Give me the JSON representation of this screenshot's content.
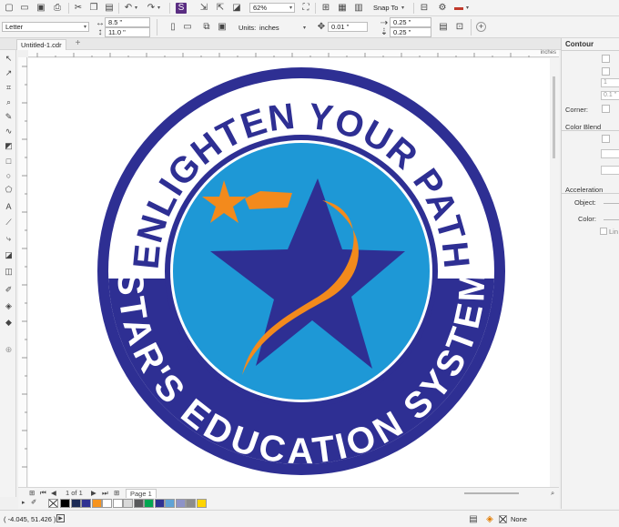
{
  "app": {
    "doc_tab": "Untitled-1.cdr",
    "add_tab": "+"
  },
  "std_toolbar": {
    "zoom": "62%",
    "snap_to": "Snap To"
  },
  "prop_bar": {
    "page_size": "Letter",
    "width": "8.5 \"",
    "height": "11.0 \"",
    "units_label": "Units:",
    "units_value": "inches",
    "nudge": "0.01 \"",
    "dup_x": "0.25 \"",
    "dup_y": "0.25 \""
  },
  "rulers": {
    "unit": "inches"
  },
  "logo": {
    "top_text": "ENLIGHTEN YOUR PATH",
    "bottom_text": "STAR'S EDUCATION SYSTEM",
    "colors": {
      "navy": "#2e2f93",
      "blue": "#1e98d6",
      "orange": "#f38a1c",
      "white": "#ffffff"
    }
  },
  "page_nav": {
    "page_count": "1 of 1",
    "page_tab": "Page 1"
  },
  "palette": {
    "swatches": [
      "#000000",
      "#1b2a55",
      "#2e3192",
      "#f7941d",
      "#ffffff",
      "#ffffff",
      "#d9d9d9",
      "#58595b",
      "#00a651",
      "#2e3192",
      "#5fa3d6",
      "#8d93c8",
      "#8c8c8c",
      "#ffd400"
    ]
  },
  "status": {
    "coordinates": "( -4.045, 51.426 )",
    "fill_label": "None"
  },
  "docker": {
    "title": "Contour",
    "steps_value": "1",
    "offset_value": "0.1 \"",
    "corner_label": "Corner:",
    "color_blend_label": "Color Blend",
    "acceleration_label": "Acceleration",
    "object_label": "Object:",
    "color_label": "Color:",
    "link_label": "Lin"
  },
  "icons": [
    "new-icon",
    "open-icon",
    "save-icon",
    "print-icon",
    "undo-icon",
    "redo-icon",
    "zoom-icon",
    "pick-tool-icon",
    "shape-tool-icon",
    "crop-icon",
    "freehand-icon",
    "rectangle-icon",
    "ellipse-icon",
    "polygon-icon",
    "text-icon",
    "fill-icon",
    "eyedropper-icon"
  ]
}
